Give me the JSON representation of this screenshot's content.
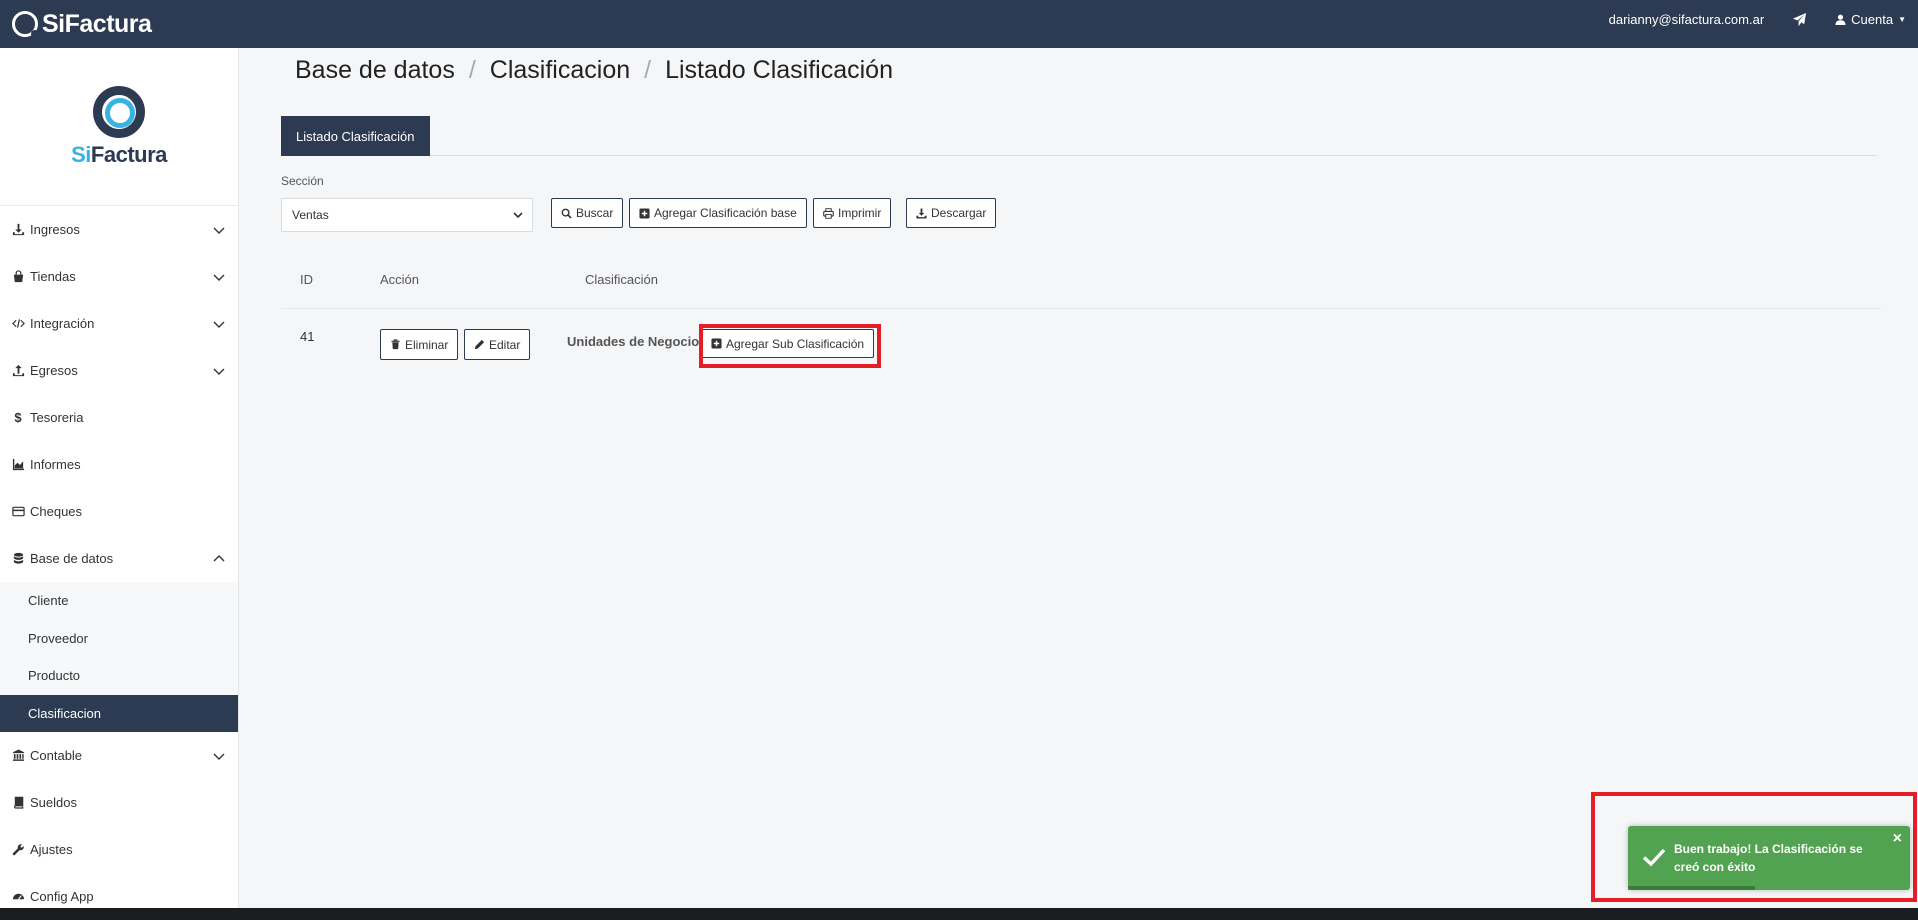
{
  "topbar": {
    "brand": "SiFactura",
    "email": "darianny@sifactura.com.ar",
    "account_label": "Cuenta"
  },
  "sidebar": {
    "logo_si": "Si",
    "logo_factura": "Factura",
    "items": [
      {
        "label": "Ingresos",
        "icon": "download-icon"
      },
      {
        "label": "Tiendas",
        "icon": "shopping-bag-icon"
      },
      {
        "label": "Integración",
        "icon": "code-icon"
      },
      {
        "label": "Egresos",
        "icon": "upload-icon"
      },
      {
        "label": "Tesoreria",
        "icon": "dollar-icon"
      },
      {
        "label": "Informes",
        "icon": "area-chart-icon"
      },
      {
        "label": "Cheques",
        "icon": "credit-card-icon"
      },
      {
        "label": "Base de datos",
        "icon": "database-icon"
      },
      {
        "label": "Contable",
        "icon": "bank-icon"
      },
      {
        "label": "Sueldos",
        "icon": "book-icon"
      },
      {
        "label": "Ajustes",
        "icon": "wrench-icon"
      },
      {
        "label": "Config App",
        "icon": "tachometer-icon"
      }
    ],
    "subitems": [
      "Cliente",
      "Proveedor",
      "Producto",
      "Clasificacion"
    ]
  },
  "breadcrumb": [
    "Base de datos",
    "Clasificacion",
    "Listado Clasificación"
  ],
  "tab": "Listado Clasificación",
  "filter": {
    "section_label": "Sección",
    "section_value": "Ventas"
  },
  "buttons": {
    "buscar": "Buscar",
    "agregar_base": "Agregar Clasificación base",
    "imprimir": "Imprimir",
    "descargar": "Descargar"
  },
  "table": {
    "headers": [
      "ID",
      "Acción",
      "Clasificación"
    ],
    "rows": [
      {
        "id": "41",
        "eliminar": "Eliminar",
        "editar": "Editar",
        "clasificacion": "Unidades de Negocio",
        "agregar_sub": "Agregar Sub Clasificación"
      }
    ]
  },
  "toast": {
    "message": "Buen trabajo! La Clasificación se creó con éxito",
    "close": "×",
    "progress": 0.45,
    "color": "#51a351"
  },
  "colors": {
    "navy": "#2c3a52",
    "accent": "#36b3e0",
    "highlight": "#e31e24"
  }
}
